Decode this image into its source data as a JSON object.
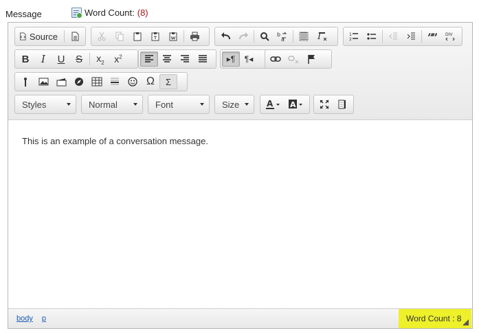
{
  "field_label": "Message",
  "word_count_header": {
    "label": "Word Count:",
    "count": "(8)"
  },
  "toolbar": {
    "source_label": "Source",
    "combos": {
      "styles": "Styles",
      "format": "Normal",
      "font": "Font",
      "size": "Size"
    },
    "icons": [
      "source-icon",
      "templates-icon",
      "cut-icon",
      "copy-icon",
      "paste-icon",
      "paste-text-icon",
      "paste-word-icon",
      "print-icon",
      "undo-icon",
      "redo-icon",
      "find-icon",
      "replace-icon",
      "select-all-icon",
      "remove-format-icon",
      "numbered-list-icon",
      "bulleted-list-icon",
      "decrease-indent-icon",
      "increase-indent-icon",
      "blockquote-icon",
      "div-container-icon",
      "bold-icon",
      "italic-icon",
      "underline-icon",
      "strikethrough-icon",
      "subscript-icon",
      "superscript-icon",
      "align-left-icon",
      "align-center-icon",
      "align-right-icon",
      "justify-icon",
      "ltr-icon",
      "rtl-icon",
      "link-icon",
      "unlink-icon",
      "anchor-icon",
      "flash-icon",
      "image-icon",
      "video-icon",
      "iframe-icon",
      "table-icon",
      "horizontal-rule-icon",
      "smiley-icon",
      "special-char-icon",
      "math-icon",
      "text-color-icon",
      "background-color-icon",
      "maximize-icon",
      "show-blocks-icon"
    ]
  },
  "content": {
    "text": "This is an example of a conversation message."
  },
  "statusbar": {
    "path": [
      "body",
      "p"
    ],
    "word_count": "Word Count : 8"
  },
  "colors": {
    "highlight": "#eef02a",
    "link": "#1f5bb5",
    "count": "#a01818"
  }
}
